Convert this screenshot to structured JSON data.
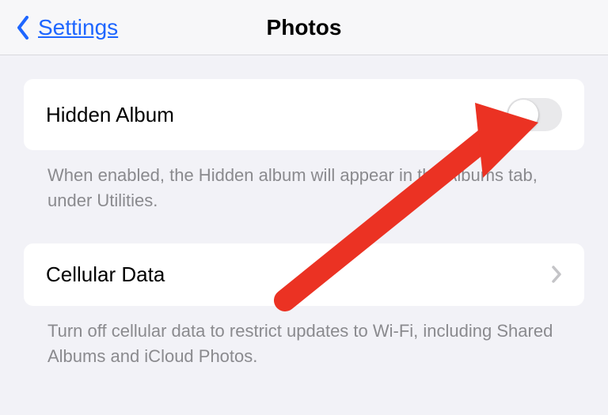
{
  "nav": {
    "back_label": "Settings",
    "title": "Photos"
  },
  "hidden_album": {
    "label": "Hidden Album",
    "toggle_on": false,
    "footer": "When enabled, the Hidden album will appear in the Albums tab, under Utilities."
  },
  "cellular_data": {
    "label": "Cellular Data",
    "footer": "Turn off cellular data to restrict updates to Wi-Fi, including Shared Albums and iCloud Photos."
  },
  "annotation": {
    "arrow_color": "#eb3223"
  }
}
